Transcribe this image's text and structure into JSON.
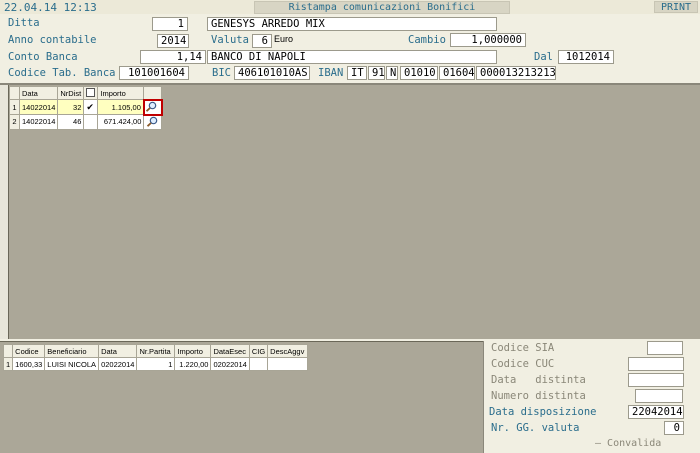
{
  "titlebar": {
    "datetime": "22.04.14 12:13",
    "title": "Ristampa comunicazioni Bonifici",
    "print": "PRINT"
  },
  "form": {
    "ditta_label": "Ditta",
    "ditta_code": "1",
    "ditta_name": "GENESYS ARREDO MIX",
    "anno_label": "Anno contabile",
    "anno_value": "2014",
    "valuta_label": "Valuta",
    "valuta_code": "6",
    "valuta_name": "Euro",
    "cambio_label": "Cambio",
    "cambio_value": "1,000000",
    "conto_label": "Conto Banca",
    "conto_value": "1,14",
    "conto_name": "BANCO DI NAPOLI",
    "dal_label": "Dal",
    "dal_value": "1012014",
    "codtab_label": "Codice Tab. Banca",
    "codtab_value": "101001604",
    "bic_label": "BIC",
    "bic_value": "406101010AS",
    "iban_label": "IBAN",
    "iban_country": "IT",
    "iban_check": "91",
    "iban_cin": "N",
    "iban_abi": "01010",
    "iban_cab": "01604",
    "iban_conto": "000013213213"
  },
  "distinte": {
    "headers": [
      "Data",
      "NrDist",
      "",
      "Importo",
      ""
    ],
    "rows": [
      {
        "n": "1",
        "data": "14022014",
        "nrdist": "32",
        "check": "✔",
        "importo": "1.105,00"
      },
      {
        "n": "2",
        "data": "14022014",
        "nrdist": "46",
        "check": "",
        "importo": "671.424,00"
      }
    ]
  },
  "dettaglio": {
    "headers": [
      "Codice",
      "Beneficiario",
      "Data",
      "Nr.Partita",
      "Importo",
      "DataEsec",
      "CIG",
      "DescAggv"
    ],
    "rows": [
      {
        "n": "1",
        "codice": "1600,33",
        "beneficiario": "LUISI NICOLA",
        "data": "02022014",
        "partita": "1",
        "importo": "1.220,00",
        "dataesec": "02022014",
        "cig": "",
        "desc": ""
      }
    ]
  },
  "side": {
    "sia_label": "Codice SIA",
    "sia_value": "",
    "cuc_label": "Codice CUC",
    "cuc_value": "",
    "data_distinta_label": "Data   distinta",
    "data_distinta_value": "",
    "numero_distinta_label": "Numero distinta",
    "numero_distinta_value": "",
    "data_disp_label": "Data disposizione",
    "data_disp_value": "22042014",
    "nrgg_label": "Nr. GG. valuta",
    "nrgg_value": "0",
    "convalida_label": "Convalida"
  }
}
